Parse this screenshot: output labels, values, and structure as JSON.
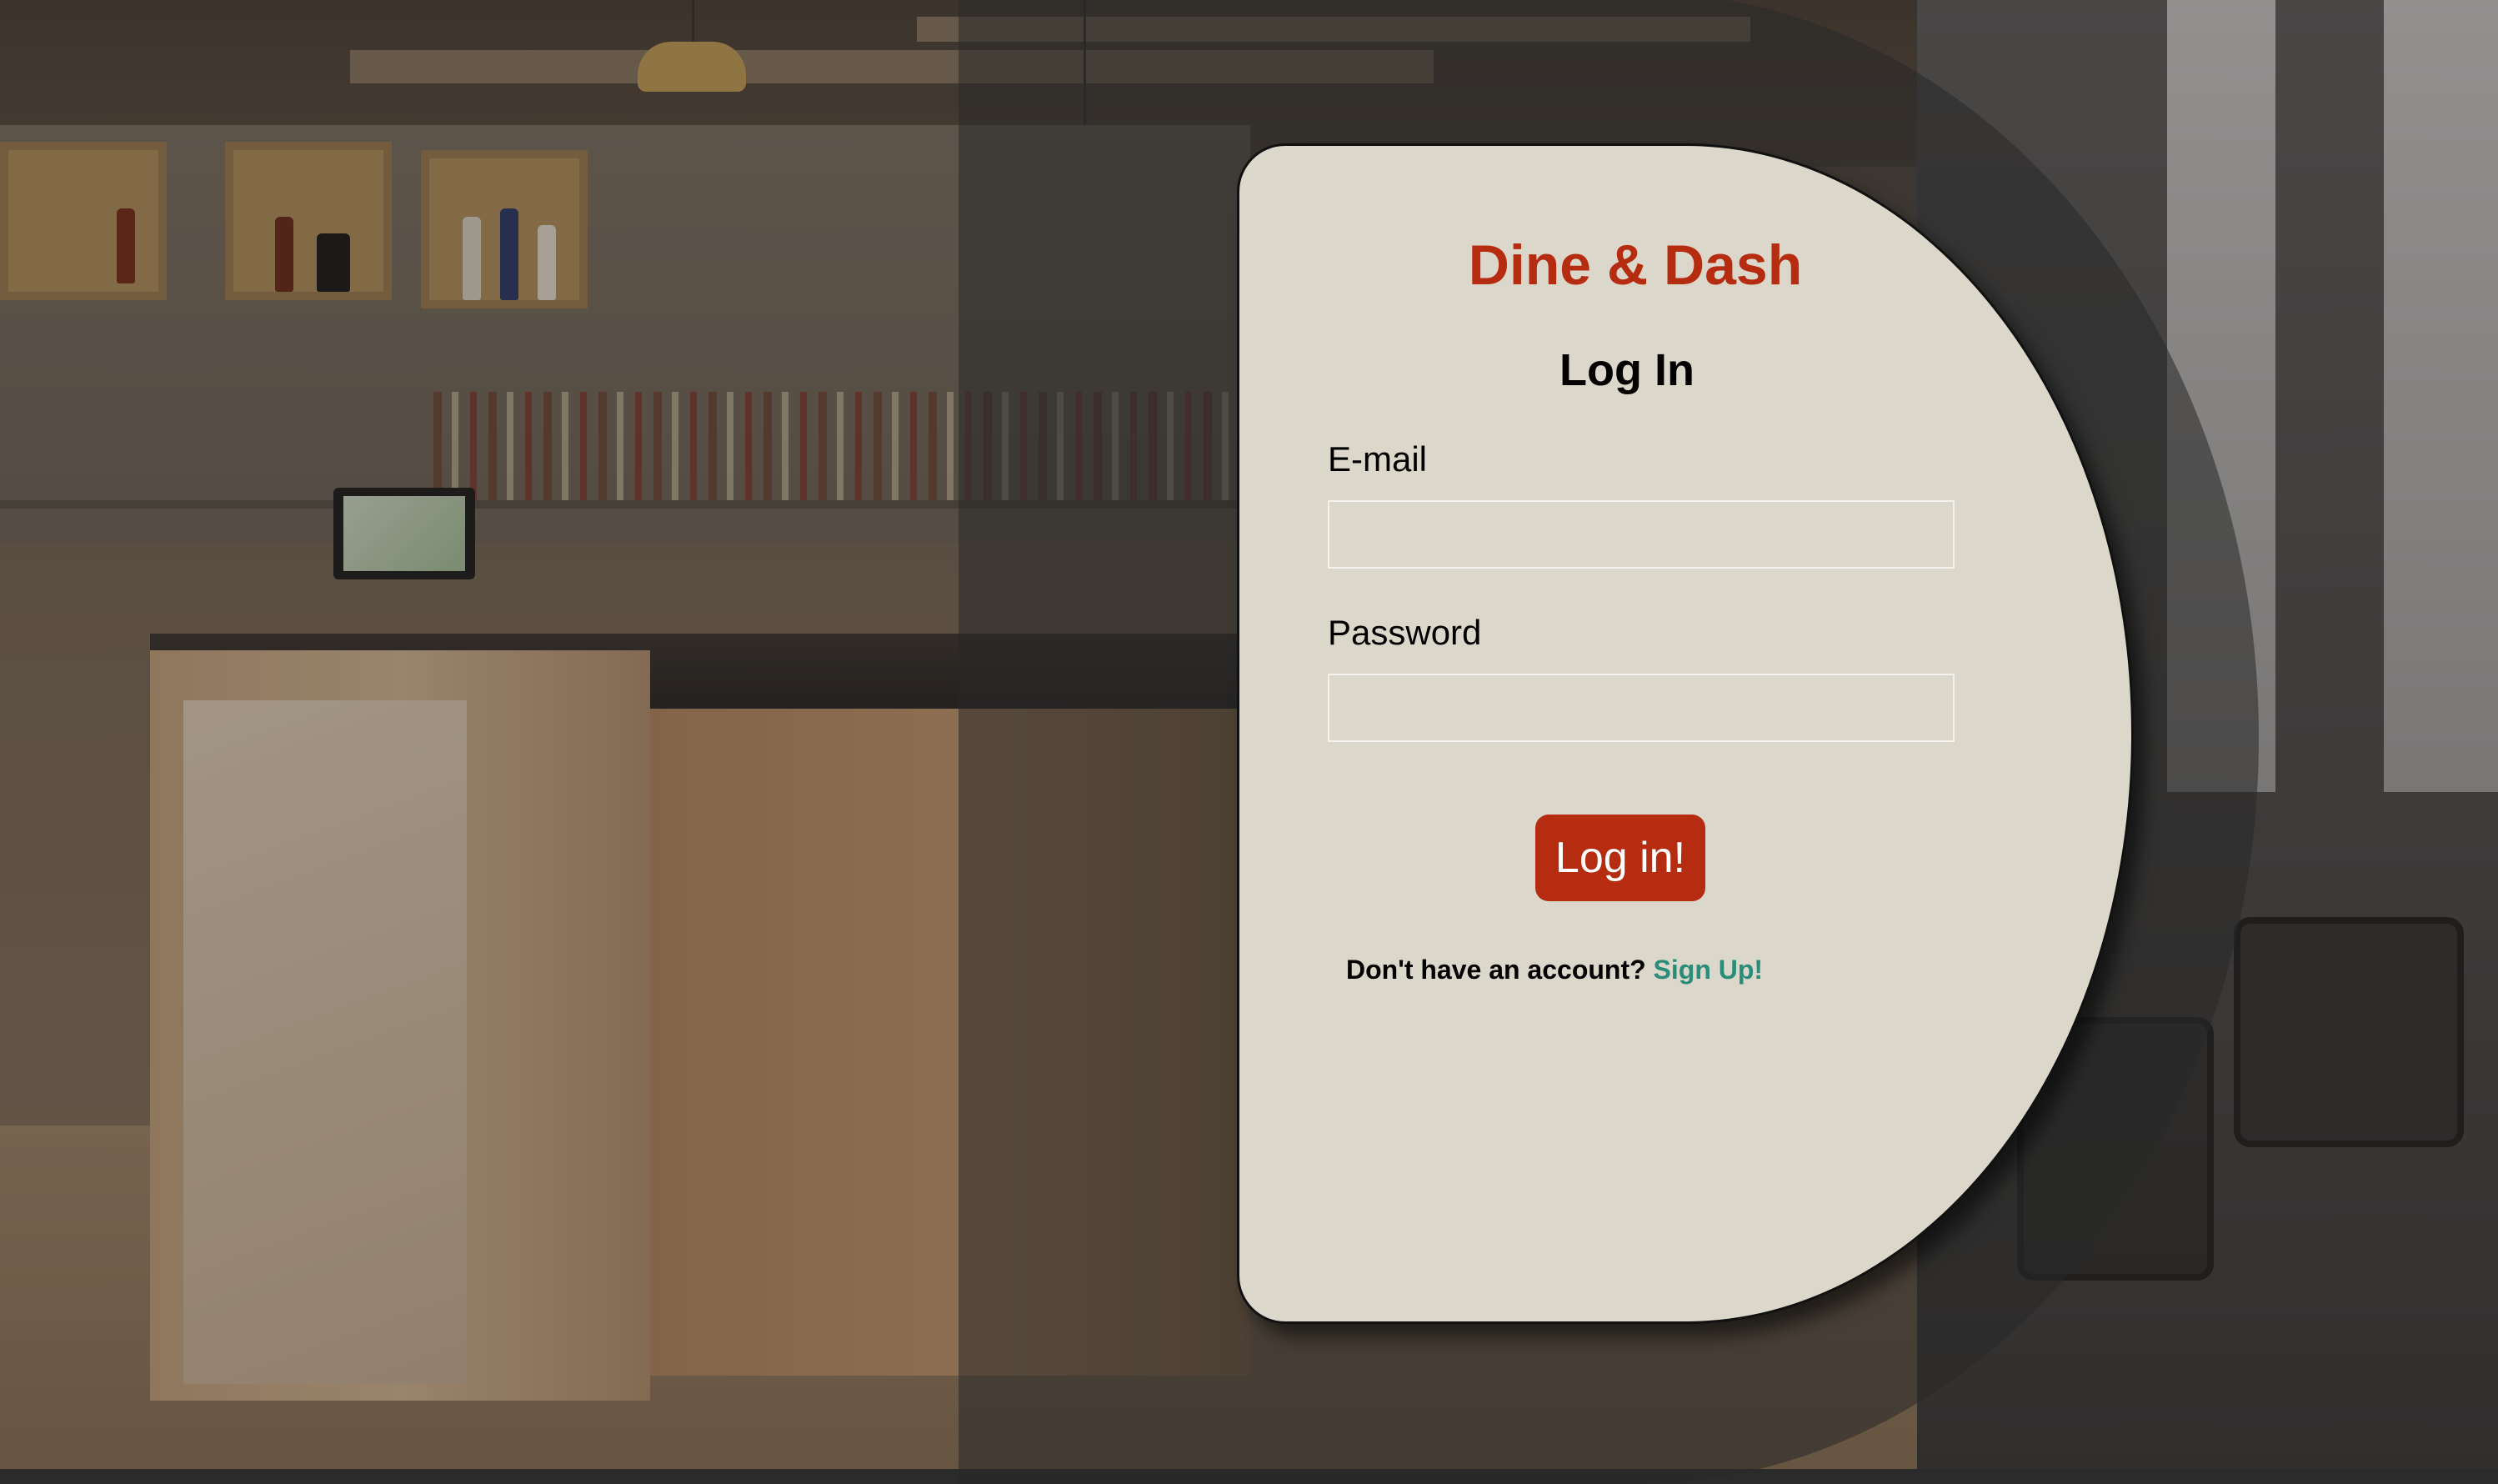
{
  "app": {
    "brand": "Dine & Dash"
  },
  "login_form": {
    "heading": "Log In",
    "email_label": "E-mail",
    "email_value": "",
    "password_label": "Password",
    "password_value": "",
    "submit_label": "Log in!",
    "signup_prompt": "Don't have an account?",
    "signup_link": "Sign Up!"
  },
  "colors": {
    "brand": "#b52c10",
    "card_background": "#dbd7ca",
    "link": "#2a8c7a",
    "button_text": "#ffffff"
  }
}
